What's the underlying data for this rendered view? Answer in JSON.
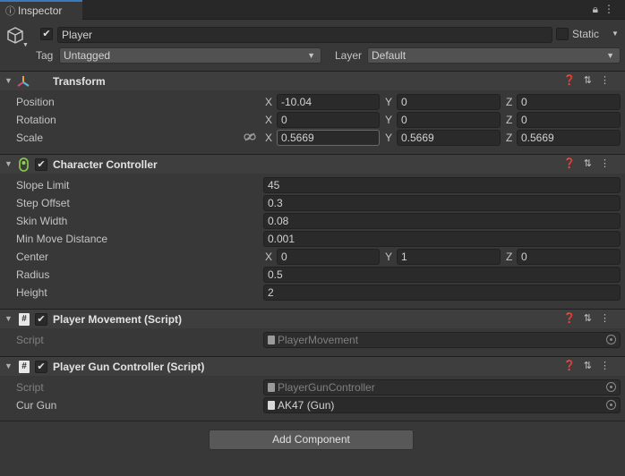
{
  "window": {
    "tab_label": "Inspector",
    "tools": "⋮"
  },
  "gameobject": {
    "name": "Player",
    "static_label": "Static",
    "tag_label": "Tag",
    "tag_value": "Untagged",
    "layer_label": "Layer",
    "layer_value": "Default"
  },
  "transform": {
    "title": "Transform",
    "rows": [
      {
        "label": "Position",
        "x": "-10.04",
        "y": "0",
        "z": "0"
      },
      {
        "label": "Rotation",
        "x": "0",
        "y": "0",
        "z": "0"
      },
      {
        "label": "Scale",
        "x": "0.5669",
        "y": "0.5669",
        "z": "0.5669"
      }
    ]
  },
  "axes": {
    "x": "X",
    "y": "Y",
    "z": "Z"
  },
  "character_controller": {
    "title": "Character Controller",
    "slope_limit": {
      "label": "Slope Limit",
      "value": "45"
    },
    "step_offset": {
      "label": "Step Offset",
      "value": "0.3"
    },
    "skin_width": {
      "label": "Skin Width",
      "value": "0.08"
    },
    "min_move_distance": {
      "label": "Min Move Distance",
      "value": "0.001"
    },
    "center": {
      "label": "Center",
      "x": "0",
      "y": "1",
      "z": "0"
    },
    "radius": {
      "label": "Radius",
      "value": "0.5"
    },
    "height": {
      "label": "Height",
      "value": "2"
    }
  },
  "player_movement": {
    "title": "Player Movement (Script)",
    "script_label": "Script",
    "script_value": "PlayerMovement"
  },
  "player_gun_controller": {
    "title": "Player Gun Controller (Script)",
    "script_label": "Script",
    "script_value": "PlayerGunController",
    "cur_gun_label": "Cur Gun",
    "cur_gun_value": "AK47 (Gun)"
  },
  "add_component_label": "Add Component",
  "icons": [
    "inspector-icon",
    "lock-icon",
    "more-icon",
    "cube-icon",
    "checkmark-icon",
    "transform-icon",
    "character-controller-icon",
    "script-icon",
    "help-icon",
    "presets-icon",
    "kebab-icon",
    "link-icon",
    "object-picker-icon"
  ]
}
